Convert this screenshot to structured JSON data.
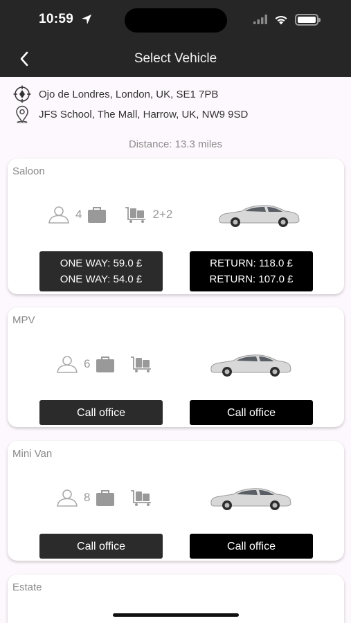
{
  "status": {
    "time": "10:59"
  },
  "header": {
    "title": "Select Vehicle"
  },
  "route": {
    "pickup": "Ojo de Londres, London, UK, SE1 7PB",
    "dropoff": "JFS School, The Mall, Harrow, UK, NW9 9SD",
    "distance": "Distance: 13.3 miles"
  },
  "vehicles": [
    {
      "name": "Saloon",
      "passengers": "4",
      "luggage": "2+2",
      "one_way_1": "ONE WAY: 59.0 £",
      "one_way_2": "ONE WAY: 54.0 £",
      "return_1": "RETURN: 118.0 £",
      "return_2": "RETURN: 107.0 £"
    },
    {
      "name": "MPV",
      "passengers": "6",
      "left_button": "Call office",
      "right_button": "Call office"
    },
    {
      "name": "Mini Van",
      "passengers": "8",
      "left_button": "Call office",
      "right_button": "Call office"
    },
    {
      "name": "Estate"
    }
  ],
  "colors": {
    "header_bg": "#262626",
    "page_bg": "#fdf8fd",
    "button_dark": "#2b2b2b",
    "button_black": "#000000"
  }
}
